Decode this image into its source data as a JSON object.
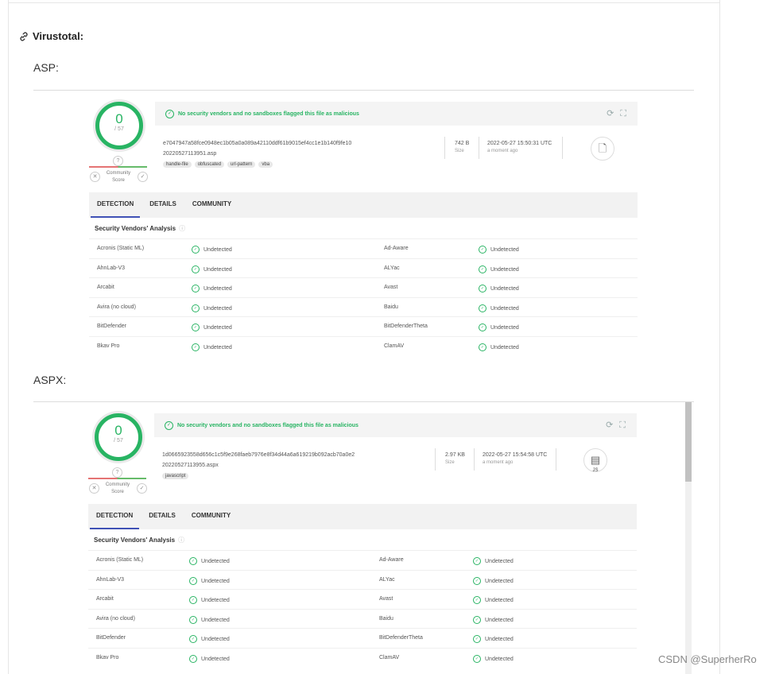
{
  "heading": "Virustotal:",
  "sections": [
    {
      "label": "ASP:",
      "score": "0",
      "score_total": "/ 57",
      "community_label": "Community Score",
      "banner_message": "No security vendors and no sandboxes flagged this file as malicious",
      "hash": "e7047947a58fce0948ec1b05a0a089a42110ddf61b9015ef4cc1e1b140f9fe10",
      "filename": "20220527113951.asp",
      "tags": [
        "handle-file",
        "obfuscated",
        "url-pattern",
        "vba"
      ],
      "size": "742 B",
      "size_label": "Size",
      "date": "2022-05-27 15:50:31 UTC",
      "date_relative": "a moment ago",
      "file_type_icon": "document-icon",
      "file_type_text": "",
      "tabs": [
        "DETECTION",
        "DETAILS",
        "COMMUNITY"
      ],
      "section_title": "Security Vendors' Analysis",
      "vendors": [
        [
          "Acronis (Static ML)",
          "Undetected",
          "Ad-Aware",
          "Undetected"
        ],
        [
          "AhnLab-V3",
          "Undetected",
          "ALYac",
          "Undetected"
        ],
        [
          "Arcabit",
          "Undetected",
          "Avast",
          "Undetected"
        ],
        [
          "Avira (no cloud)",
          "Undetected",
          "Baidu",
          "Undetected"
        ],
        [
          "BitDefender",
          "Undetected",
          "BitDefenderTheta",
          "Undetected"
        ],
        [
          "Bkav Pro",
          "Undetected",
          "ClamAV",
          "Undetected"
        ]
      ]
    },
    {
      "label": "ASPX:",
      "score": "0",
      "score_total": "/ 57",
      "community_label": "Community Score",
      "banner_message": "No security vendors and no sandboxes flagged this file as malicious",
      "hash": "1d0665923558d656c1c5f9e268faeb7976e8f34d44a6a619219b092acb70a0e2",
      "filename": "20220527113955.aspx",
      "tags": [
        "javascript"
      ],
      "size": "2.97 KB",
      "size_label": "Size",
      "date": "2022-05-27 15:54:58 UTC",
      "date_relative": "a moment ago",
      "file_type_icon": "js-file-icon",
      "file_type_text": "JS",
      "tabs": [
        "DETECTION",
        "DETAILS",
        "COMMUNITY"
      ],
      "section_title": "Security Vendors' Analysis",
      "vendors": [
        [
          "Acronis (Static ML)",
          "Undetected",
          "Ad-Aware",
          "Undetected"
        ],
        [
          "AhnLab-V3",
          "Undetected",
          "ALYac",
          "Undetected"
        ],
        [
          "Arcabit",
          "Undetected",
          "Avast",
          "Undetected"
        ],
        [
          "Avira (no cloud)",
          "Undetected",
          "Baidu",
          "Undetected"
        ],
        [
          "BitDefender",
          "Undetected",
          "BitDefenderTheta",
          "Undetected"
        ],
        [
          "Bkav Pro",
          "Undetected",
          "ClamAV",
          "Undetected"
        ]
      ]
    }
  ],
  "watermark": "CSDN @SuperherRo",
  "colors": {
    "clean": "#28b463",
    "tab_underline": "#3f51b5"
  }
}
